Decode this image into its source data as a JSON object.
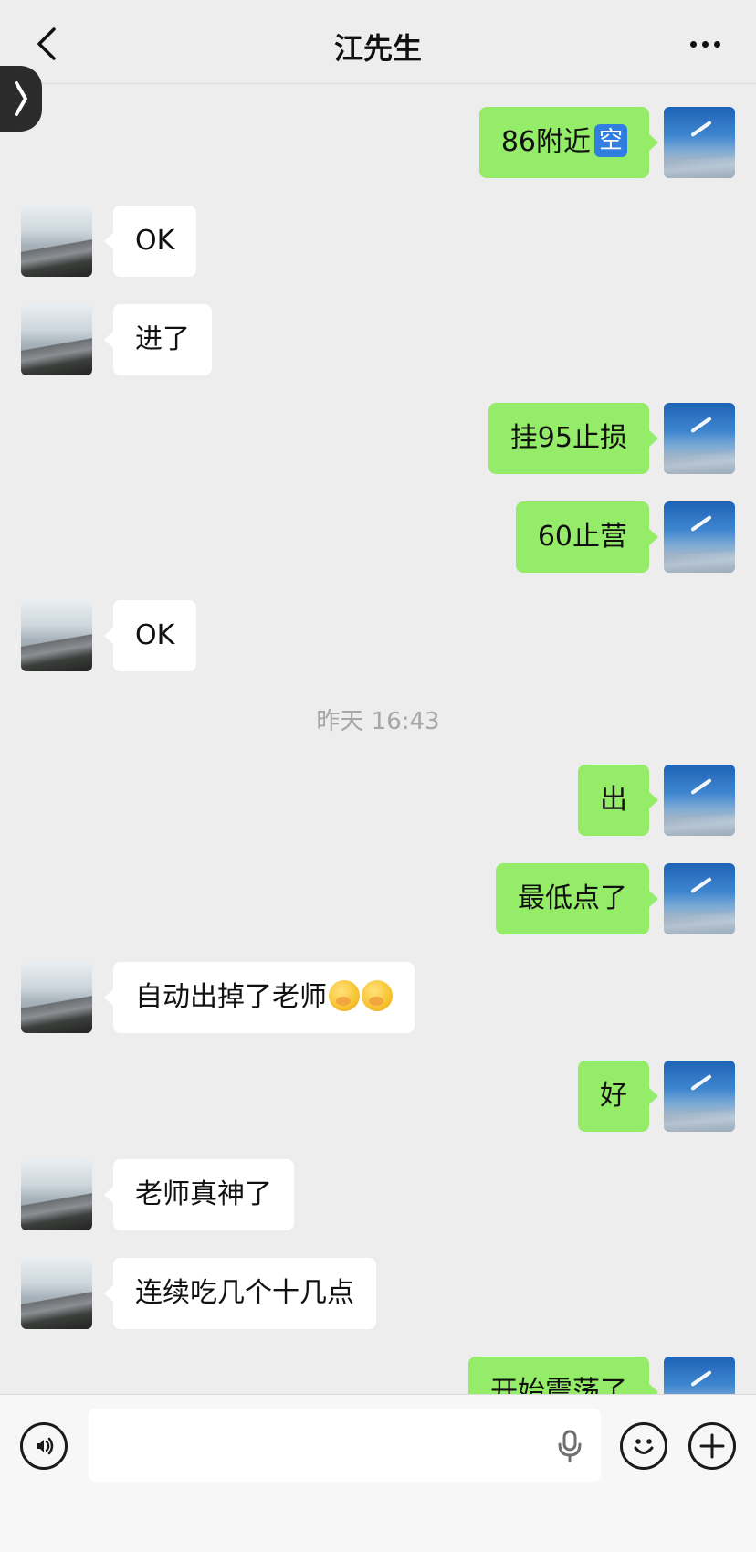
{
  "header": {
    "title": "江先生"
  },
  "messages": [
    {
      "side": "right",
      "text": "86附近",
      "badge": "空"
    },
    {
      "side": "left",
      "text": "OK"
    },
    {
      "side": "left",
      "text": "进了"
    },
    {
      "side": "right",
      "text": "挂95止损"
    },
    {
      "side": "right",
      "text": "60止营"
    },
    {
      "side": "left",
      "text": "OK"
    },
    {
      "side": "right",
      "text": "出"
    },
    {
      "side": "right",
      "text": "最低点了"
    },
    {
      "side": "left",
      "text": "自动出掉了老师",
      "emoji_count": 2
    },
    {
      "side": "right",
      "text": "好"
    },
    {
      "side": "left",
      "text": "老师真神了"
    },
    {
      "side": "left",
      "text": "连续吃几个十几点"
    },
    {
      "side": "right",
      "text": "开始震荡了"
    }
  ],
  "timestamp": "昨天 16:43",
  "input": {
    "value": "",
    "placeholder": ""
  },
  "icons": {
    "back": "chevron-left-icon",
    "more": "more-dots-icon",
    "side_tab": "chevron-right-icon",
    "voice": "voice-icon",
    "mic": "microphone-icon",
    "emoji": "emoji-icon",
    "plus": "plus-icon"
  },
  "colors": {
    "background": "#ededed",
    "bubble_self": "#95ec69",
    "bubble_other": "#ffffff",
    "timestamp": "#a6a6a6"
  }
}
